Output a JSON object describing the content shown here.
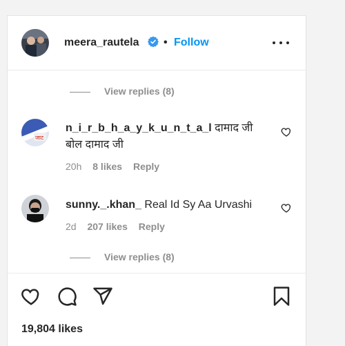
{
  "post": {
    "username": "meera_rautela",
    "separator": "•",
    "follow_label": "Follow",
    "likes_count": "19,804 likes"
  },
  "view_replies_top": "View replies (8)",
  "view_replies_bottom": "View replies (8)",
  "comments": [
    {
      "username": "n_i_r_b_h_a_y_k_u_n_t_a_l",
      "text": "दामाद जी बोल दामाद जी",
      "time": "20h",
      "likes": "8 likes",
      "reply": "Reply"
    },
    {
      "username": "sunny._.khan_",
      "text": "Real Id Sy Aa Urvashi",
      "time": "2d",
      "likes": "207 likes",
      "reply": "Reply"
    }
  ],
  "icons": {
    "verified": "verified-badge-icon",
    "more": "more-options-icon",
    "like": "heart-icon",
    "comment": "comment-icon",
    "share": "share-icon",
    "save": "bookmark-icon"
  },
  "colors": {
    "accent": "#0095f6",
    "text": "#262626",
    "secondary": "#8e8e8e"
  }
}
